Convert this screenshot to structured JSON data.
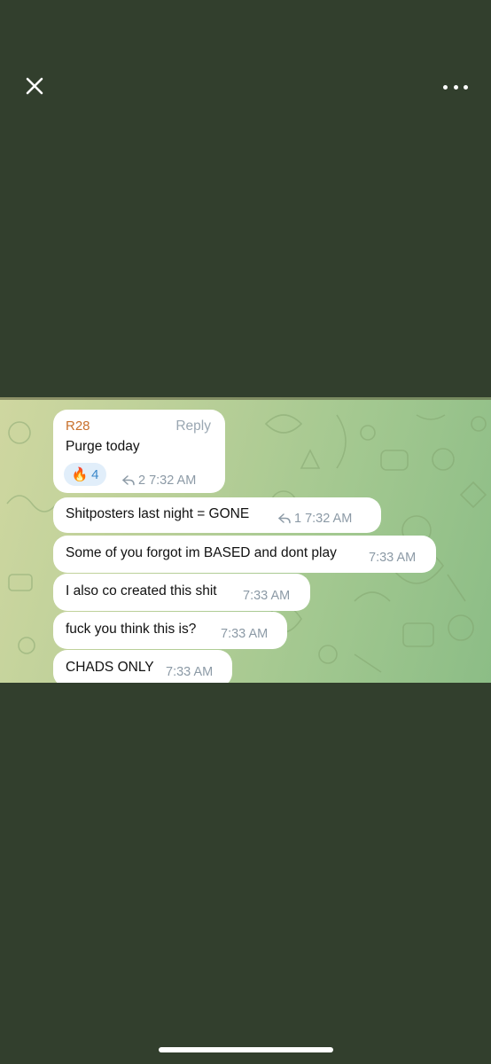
{
  "toolbar": {
    "close_icon": "close-icon",
    "more_icon": "more-horizontal-icon"
  },
  "colors": {
    "background": "#323f2d",
    "bubble": "#ffffff",
    "sender_name": "#c8702b",
    "meta_text": "#8c9aa6",
    "reaction_bg": "#e1eefa",
    "reaction_text": "#3a87c9"
  },
  "messages": [
    {
      "sender": "R28",
      "reply_label": "Reply",
      "text": "Purge today",
      "reaction": {
        "emoji": "🔥",
        "count": "4"
      },
      "replies": "2",
      "time": "7:32 AM"
    },
    {
      "text": "Shitposters last night = GONE",
      "replies": "1",
      "time": "7:32 AM"
    },
    {
      "text": "Some of you forgot im BASED and dont play",
      "time": "7:33 AM"
    },
    {
      "text": "I also co created this shit",
      "time": "7:33 AM"
    },
    {
      "text": "fuck you think this is?",
      "time": "7:33 AM"
    },
    {
      "text": "CHADS ONLY",
      "time": "7:33 AM"
    }
  ]
}
